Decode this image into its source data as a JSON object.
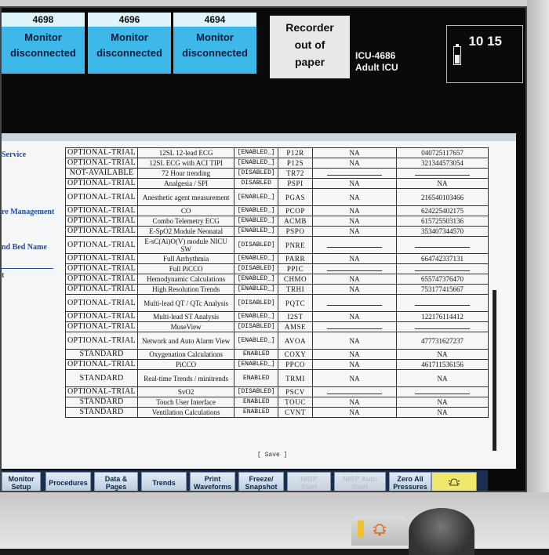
{
  "header": {
    "beds": [
      {
        "bed": "4698",
        "line1": "Monitor",
        "line2": "disconnected"
      },
      {
        "bed": "4696",
        "line1": "Monitor",
        "line2": "disconnected"
      },
      {
        "bed": "4694",
        "line1": "Monitor",
        "line2": "disconnected"
      }
    ],
    "recorder": {
      "line1": "Recorder",
      "line2": "out of",
      "line3": "paper"
    },
    "unit": {
      "bed": "ICU-4686",
      "name": "Adult ICU"
    },
    "clock": "10 15"
  },
  "sidebar": {
    "service": "Service",
    "management": "re Management",
    "bed_name": "nd Bed Name",
    "t": "t"
  },
  "options_table": {
    "rows": [
      {
        "license": "OPTIONAL-TRIAL",
        "option": "12SL 12-lead ECG",
        "status": "[ENABLED_]",
        "code": "P12R",
        "key": "NA",
        "serial": "040725117657"
      },
      {
        "license": "OPTIONAL-TRIAL",
        "option": "12SL ECG with ACI TIPI",
        "status": "[ENABLED_]",
        "code": "P12S",
        "key": "NA",
        "serial": "321344573054"
      },
      {
        "license": "NOT-AVAILABLE",
        "option": "72 Hour trending",
        "status": "[DISABLED]",
        "code": "TR72",
        "key": "",
        "serial": ""
      },
      {
        "license": "OPTIONAL-TRIAL",
        "option": "Analgesia / SPI",
        "status": "DISABLED",
        "code": "PSPI",
        "key": "NA",
        "serial": "NA"
      },
      {
        "license": "OPTIONAL-TRIAL",
        "option": "Anesthetic agent measurement",
        "status": "[ENABLED_]",
        "code": "PGAS",
        "key": "NA",
        "serial": "216540103466"
      },
      {
        "license": "OPTIONAL-TRIAL",
        "option": "CO",
        "status": "[ENABLED_]",
        "code": "PCOP",
        "key": "NA",
        "serial": "624225402175"
      },
      {
        "license": "OPTIONAL-TRIAL",
        "option": "Combo Telemetry ECG",
        "status": "[ENABLED_]",
        "code": "ACMB",
        "key": "NA",
        "serial": "615725503136"
      },
      {
        "license": "OPTIONAL-TRIAL",
        "option": "E-SpO2 Module Neonatal",
        "status": "[ENABLED_]",
        "code": "PSPO",
        "key": "NA",
        "serial": "353407344570"
      },
      {
        "license": "OPTIONAL-TRIAL",
        "option": "E-sC(Ai)O(V) module NICU SW",
        "status": "[DISABLED]",
        "code": "PNRE",
        "key": "",
        "serial": ""
      },
      {
        "license": "OPTIONAL-TRIAL",
        "option": "Full Arrhythmia",
        "status": "[ENABLED_]",
        "code": "PARR",
        "key": "NA",
        "serial": "664742337131"
      },
      {
        "license": "OPTIONAL-TRIAL",
        "option": "Full PiCCO",
        "status": "[DISABLED]",
        "code": "PPIC",
        "key": "",
        "serial": ""
      },
      {
        "license": "OPTIONAL-TRIAL",
        "option": "Hemodynamic Calculations",
        "status": "[ENABLED_]",
        "code": "CHMO",
        "key": "NA",
        "serial": "655747376470"
      },
      {
        "license": "OPTIONAL-TRIAL",
        "option": "High Resolution Trends",
        "status": "[ENABLED_]",
        "code": "TRHI",
        "key": "NA",
        "serial": "753177415667"
      },
      {
        "license": "OPTIONAL-TRIAL",
        "option": "Multi-lead QT / QTc Analysis",
        "status": "[DISABLED]",
        "code": "PQTC",
        "key": "",
        "serial": ""
      },
      {
        "license": "OPTIONAL-TRIAL",
        "option": "Multi-lead ST Analysis",
        "status": "[ENABLED_]",
        "code": "I2ST",
        "key": "NA",
        "serial": "122176114412"
      },
      {
        "license": "OPTIONAL-TRIAL",
        "option": "MuseView",
        "status": "[DISABLED]",
        "code": "AMSE",
        "key": "",
        "serial": ""
      },
      {
        "license": "OPTIONAL-TRIAL",
        "option": "Network and Auto Alarm View",
        "status": "[ENABLED_]",
        "code": "AVOA",
        "key": "NA",
        "serial": "477731627237"
      },
      {
        "license": "STANDARD",
        "option": "Oxygenation Calculations",
        "status": "ENABLED",
        "code": "COXY",
        "key": "NA",
        "serial": "NA"
      },
      {
        "license": "OPTIONAL-TRIAL",
        "option": "PiCCO",
        "status": "[ENABLED_]",
        "code": "PPCO",
        "key": "NA",
        "serial": "461711536156"
      },
      {
        "license": "STANDARD",
        "option": "Real-time Trends / minitrends",
        "status": "ENABLED",
        "code": "TRMI",
        "key": "NA",
        "serial": "NA"
      },
      {
        "license": "OPTIONAL-TRIAL",
        "option": "SvO2",
        "status": "[DISABLED]",
        "code": "PSCV",
        "key": "",
        "serial": ""
      },
      {
        "license": "STANDARD",
        "option": "Touch User Interface",
        "status": "ENABLED",
        "code": "TOUC",
        "key": "NA",
        "serial": "NA"
      },
      {
        "license": "STANDARD",
        "option": "Ventilation Calculations",
        "status": "ENABLED",
        "code": "CVNT",
        "key": "NA",
        "serial": "NA"
      }
    ],
    "save_label": "[ Save ]"
  },
  "softkeys": [
    {
      "id": "monitor-setup",
      "l1": "Monitor",
      "l2": "Setup",
      "enabled": true
    },
    {
      "id": "procedures",
      "l1": "Procedures",
      "l2": "",
      "enabled": true
    },
    {
      "id": "data-pages",
      "l1": "Data &",
      "l2": "Pages",
      "enabled": true
    },
    {
      "id": "trends",
      "l1": "Trends",
      "l2": "",
      "enabled": true
    },
    {
      "id": "print-waveforms",
      "l1": "Print",
      "l2": "Waveforms",
      "enabled": true
    },
    {
      "id": "freeze-snapshot",
      "l1": "Freeze/",
      "l2": "Snapshot",
      "enabled": true
    },
    {
      "id": "nibp-start",
      "l1": "NIBP",
      "l2": "Start",
      "enabled": false
    },
    {
      "id": "nibp-auto-start",
      "l1": "NIBP Auto",
      "l2": "Start",
      "enabled": false
    },
    {
      "id": "zero-all-pressures",
      "l1": "Zero All",
      "l2": "Pressures",
      "enabled": true
    }
  ],
  "colors": {
    "tile": "#3db8e8",
    "alarm_key": "#f0e86a",
    "link_text": "#1e4da0"
  }
}
